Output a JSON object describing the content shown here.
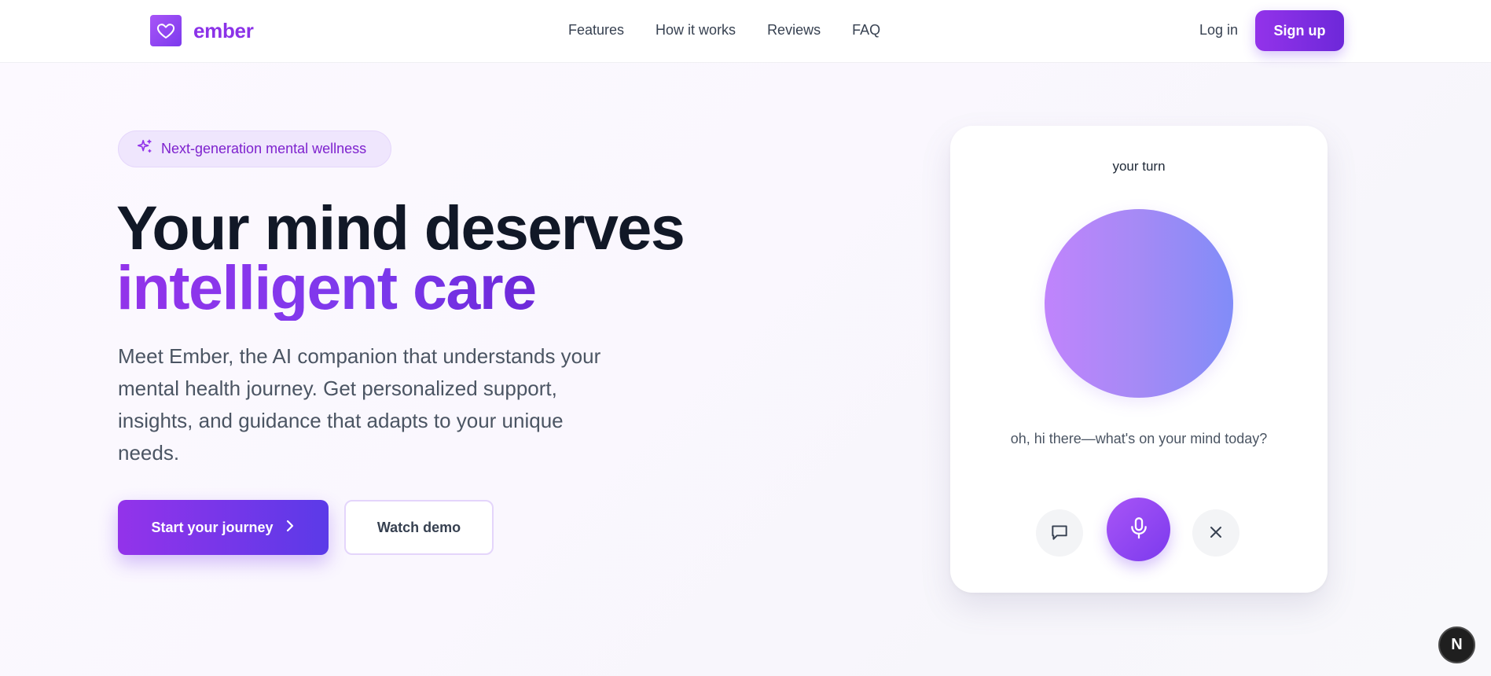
{
  "brand": {
    "name": "ember",
    "accent": "#8b32e8",
    "logo_icon": "heart-icon"
  },
  "nav": {
    "links": [
      "Features",
      "How it works",
      "Reviews",
      "FAQ"
    ],
    "login": "Log in",
    "signup": "Sign up"
  },
  "hero": {
    "badge": {
      "icon": "sparkles-icon",
      "label": "Next-generation mental wellness"
    },
    "title_line1": "Your mind deserves",
    "title_line2": "intelligent care",
    "lead": "Meet Ember, the AI companion that understands your mental health journey. Get personalized support, insights, and guidance that adapts to your unique needs.",
    "primary_cta": "Start your journey",
    "secondary_cta": "Watch demo"
  },
  "voice_card": {
    "status": "your turn",
    "message": "oh, hi there—what's on your mind today?",
    "controls": [
      "chat-icon",
      "microphone-icon",
      "close-icon"
    ]
  },
  "corner_badge": {
    "label": "N"
  }
}
